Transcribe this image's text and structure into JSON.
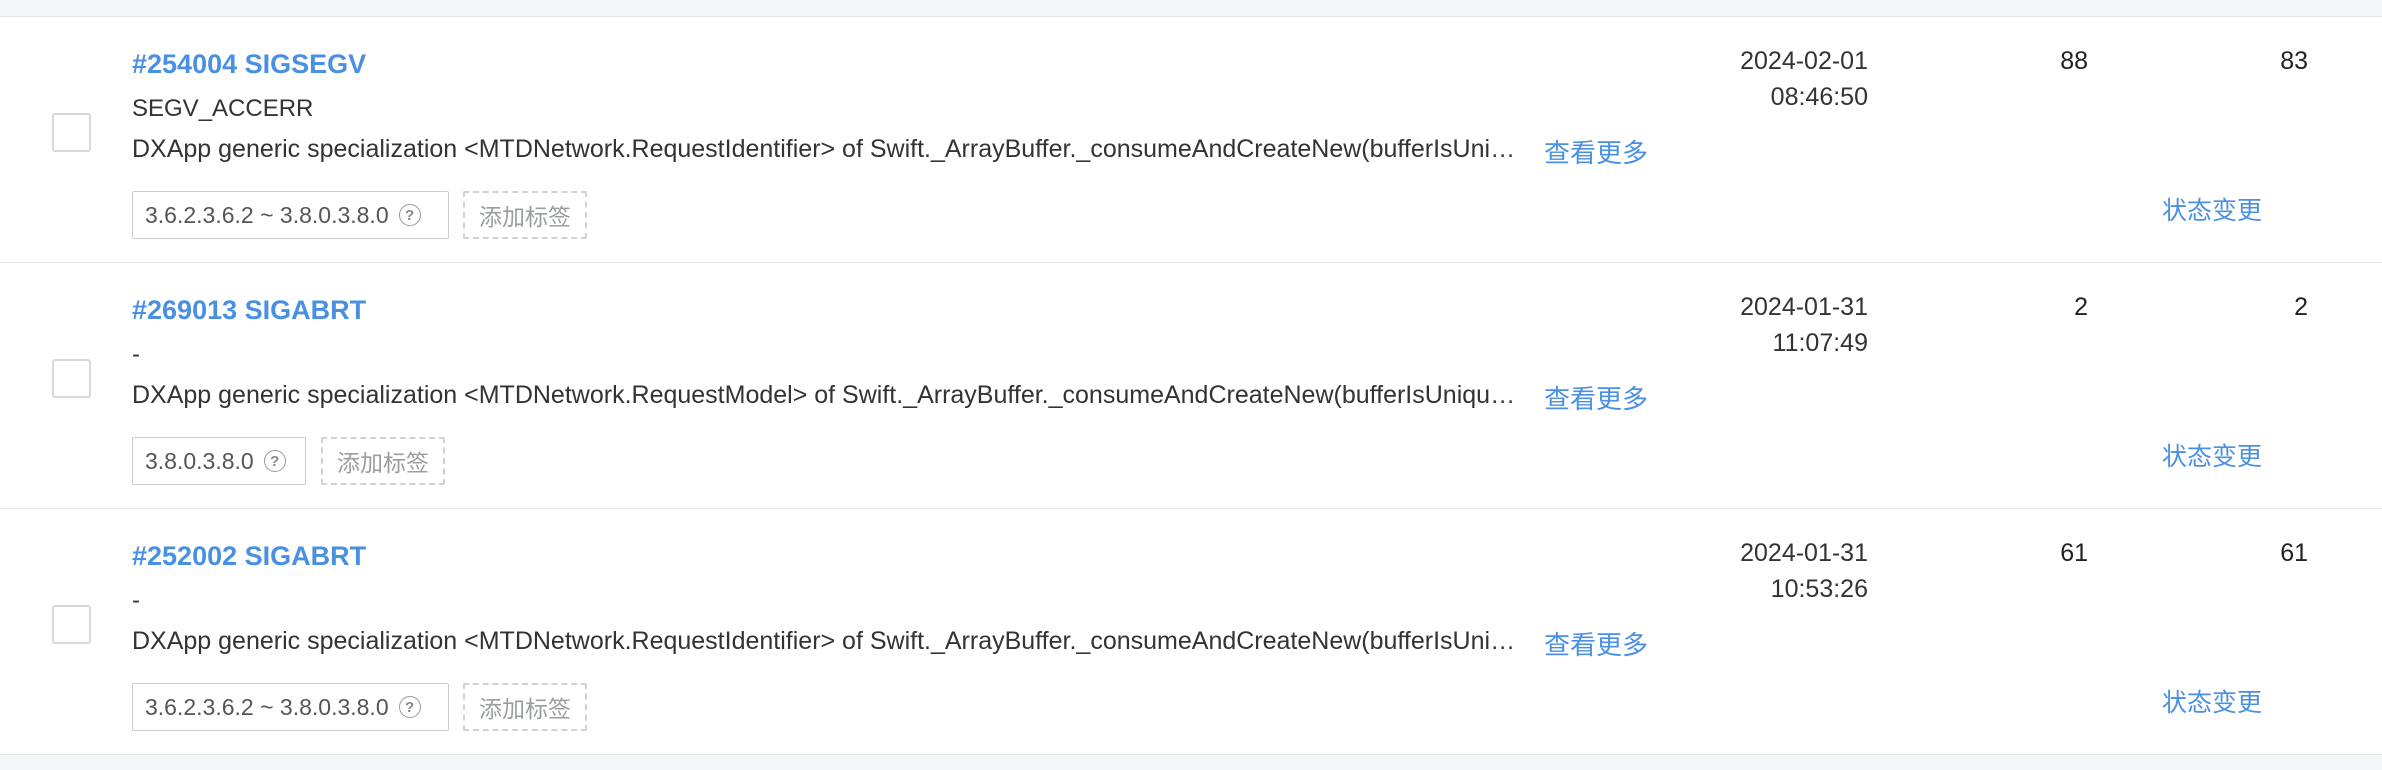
{
  "accent_color": "#4a90e2",
  "rows": [
    {
      "title": "#254004 SIGSEGV",
      "subtitle": "SEGV_ACCERR",
      "description": "DXApp generic specialization <MTDNetwork.RequestIdentifier> of Swift._ArrayBuffer._consumeAndCreateNew(bufferIsUnique:minimumCapacity:growForAppend:)",
      "more_label": "查看更多",
      "version": "3.6.2.3.6.2 ~ 3.8.0.3.8.0",
      "add_tag_label": "添加标签",
      "date": "2024-02-01",
      "time": "08:46:50",
      "count1": "88",
      "count2": "83",
      "status_label": "状态变更"
    },
    {
      "title": "#269013 SIGABRT",
      "subtitle": "-",
      "description": "DXApp generic specialization <MTDNetwork.RequestModel> of Swift._ArrayBuffer._consumeAndCreateNew(bufferIsUnique:minimumCapacity:growForAppend:)",
      "more_label": "查看更多",
      "version": "3.8.0.3.8.0",
      "add_tag_label": "添加标签",
      "date": "2024-01-31",
      "time": "11:07:49",
      "count1": "2",
      "count2": "2",
      "status_label": "状态变更"
    },
    {
      "title": "#252002 SIGABRT",
      "subtitle": "-",
      "description": "DXApp generic specialization <MTDNetwork.RequestIdentifier> of Swift._ArrayBuffer._consumeAndCreateNew(bufferIsUnique:minimumCapacity:growForAppend:)",
      "more_label": "查看更多",
      "version": "3.6.2.3.6.2 ~ 3.8.0.3.8.0",
      "add_tag_label": "添加标签",
      "date": "2024-01-31",
      "time": "10:53:26",
      "count1": "61",
      "count2": "61",
      "status_label": "状态变更"
    }
  ]
}
